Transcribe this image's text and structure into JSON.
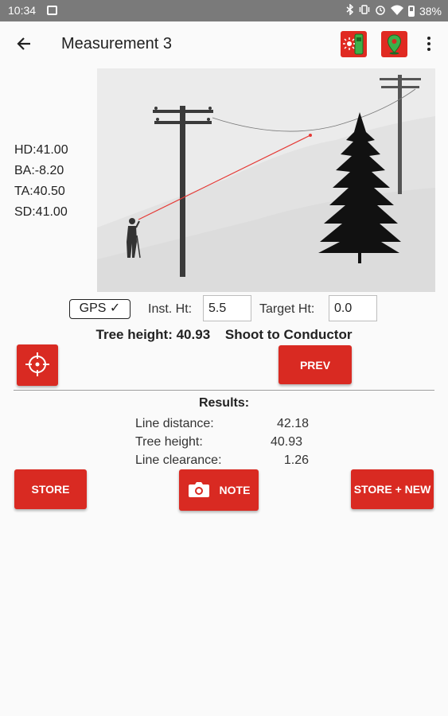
{
  "status_bar": {
    "time": "10:34",
    "battery": "38%",
    "icons": [
      "image-icon",
      "bluetooth-icon",
      "vibrate-icon",
      "alarm-icon",
      "wifi-icon",
      "battery-icon"
    ]
  },
  "app_bar": {
    "title": "Measurement 3",
    "icons": [
      "back-arrow-icon",
      "laser-rangefinder-icon",
      "map-pin-icon",
      "more-vert-icon"
    ]
  },
  "readouts": [
    {
      "label": "HD:",
      "value": "41.00"
    },
    {
      "label": "BA:",
      "value": "-8.20"
    },
    {
      "label": "TA:",
      "value": "40.50"
    },
    {
      "label": "SD:",
      "value": "41.00"
    }
  ],
  "illustration": {
    "elements": [
      "surveyor",
      "power-pole-near",
      "power-pole-far",
      "conductor-line",
      "laser-beam",
      "spruce-tree"
    ]
  },
  "controls": {
    "gps_button": "GPS ✓",
    "inst_ht_label": "Inst. Ht:",
    "inst_ht_value": "5.5",
    "target_ht_label": "Target Ht:",
    "target_ht_value": "0.0"
  },
  "status_line": {
    "tree_height": "Tree height: 40.93",
    "instruction": "Shoot to Conductor"
  },
  "buttons": {
    "target": "crosshair-icon",
    "prev": "PREV",
    "store": "STORE",
    "note": "NOTE",
    "store_new": "STORE + NEW"
  },
  "results": {
    "title": "Results:",
    "rows": [
      {
        "label": "Line distance:",
        "value": "42.18"
      },
      {
        "label": "Tree height:",
        "value": "40.93"
      },
      {
        "label": "Line clearance:",
        "value": "1.26"
      }
    ]
  },
  "colors": {
    "accent_red": "#d92a22",
    "status_bar": "#7a7a7a",
    "illustration_bg": "#ebebeb",
    "laser": "#e53935",
    "green_icon": "#3cb04a"
  }
}
